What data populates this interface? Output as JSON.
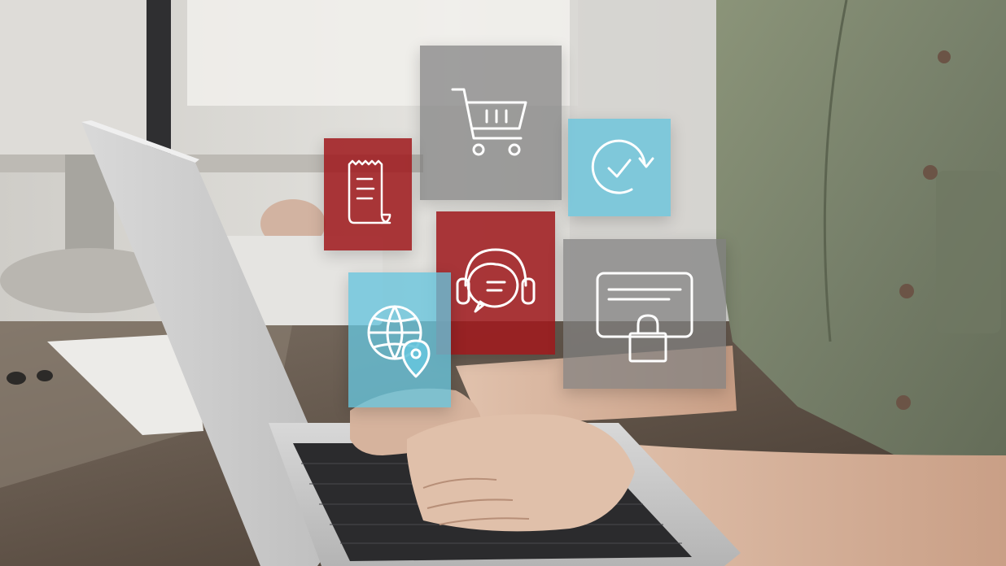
{
  "scene": {
    "subject": "person-typing-on-laptop",
    "tiles": [
      {
        "icon": "shopping-cart-icon",
        "color": "#808080"
      },
      {
        "icon": "receipt-icon",
        "color": "#9e181c"
      },
      {
        "icon": "refresh-check-icon",
        "color": "#66c4dc"
      },
      {
        "icon": "headset-chat-icon",
        "color": "#9e181c"
      },
      {
        "icon": "secure-payment-card-icon",
        "color": "#808080"
      },
      {
        "icon": "globe-location-icon",
        "color": "#66c4dc"
      }
    ]
  }
}
